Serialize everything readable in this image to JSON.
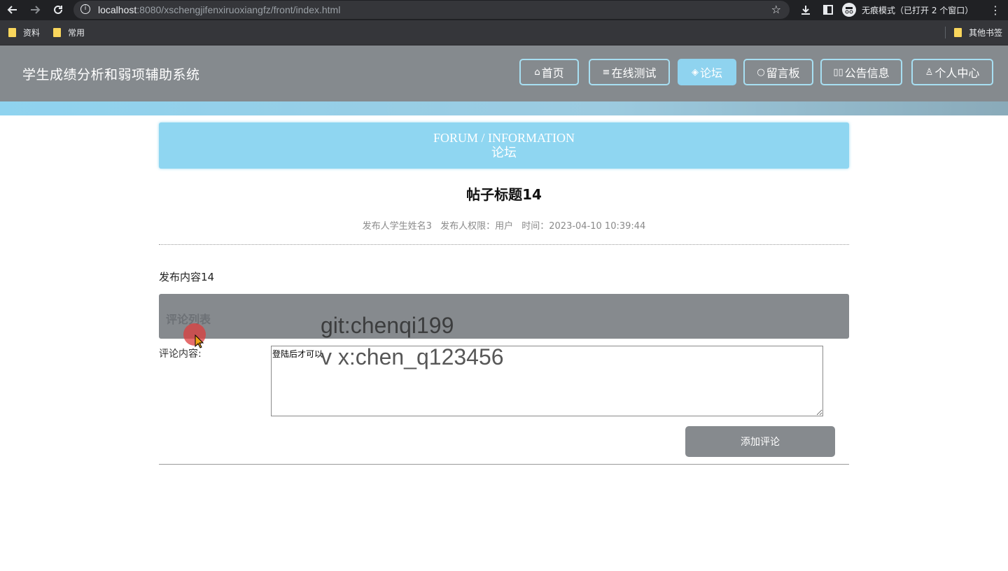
{
  "browser": {
    "url_host": "localhost",
    "url_rest": ":8080/xschengjifenxiruoxiangfz/front/index.html",
    "incognito_label": "无痕模式（已打开 2 个窗口）",
    "bookmarks": [
      "资料",
      "常用"
    ],
    "other_bookmarks": "其他书签"
  },
  "header": {
    "site_title": "学生成绩分析和弱项辅助系统",
    "nav": [
      {
        "icon": "⌂",
        "label": "首页",
        "active": false
      },
      {
        "icon": "≡",
        "label": "在线测试",
        "active": false
      },
      {
        "icon": "◈",
        "label": "论坛",
        "active": true
      },
      {
        "icon": "○",
        "label": "留言板",
        "active": false
      },
      {
        "icon": "▯▯",
        "label": "公告信息",
        "active": false
      },
      {
        "icon": "♙",
        "label": "个人中心",
        "active": false
      }
    ]
  },
  "banner": {
    "en": "FORUM / INFORMATION",
    "cn": "论坛"
  },
  "post": {
    "title": "帖子标题14",
    "author": "发布人学生姓名3",
    "role": "发布人权限：用户",
    "time": "时间：2023-04-10 10:39:44",
    "content": "发布内容14"
  },
  "comments": {
    "section_label": "评论列表",
    "input_label": "评论内容:",
    "input_placeholder": "登陆后才可以",
    "submit_label": "添加评论"
  },
  "watermark": {
    "line1": "git:chenqi199",
    "line2": "v x:chen_q123456"
  },
  "colors": {
    "header_bg": "#858a8e",
    "accent": "#8fd3ef",
    "button_bg": "#868a8e"
  }
}
